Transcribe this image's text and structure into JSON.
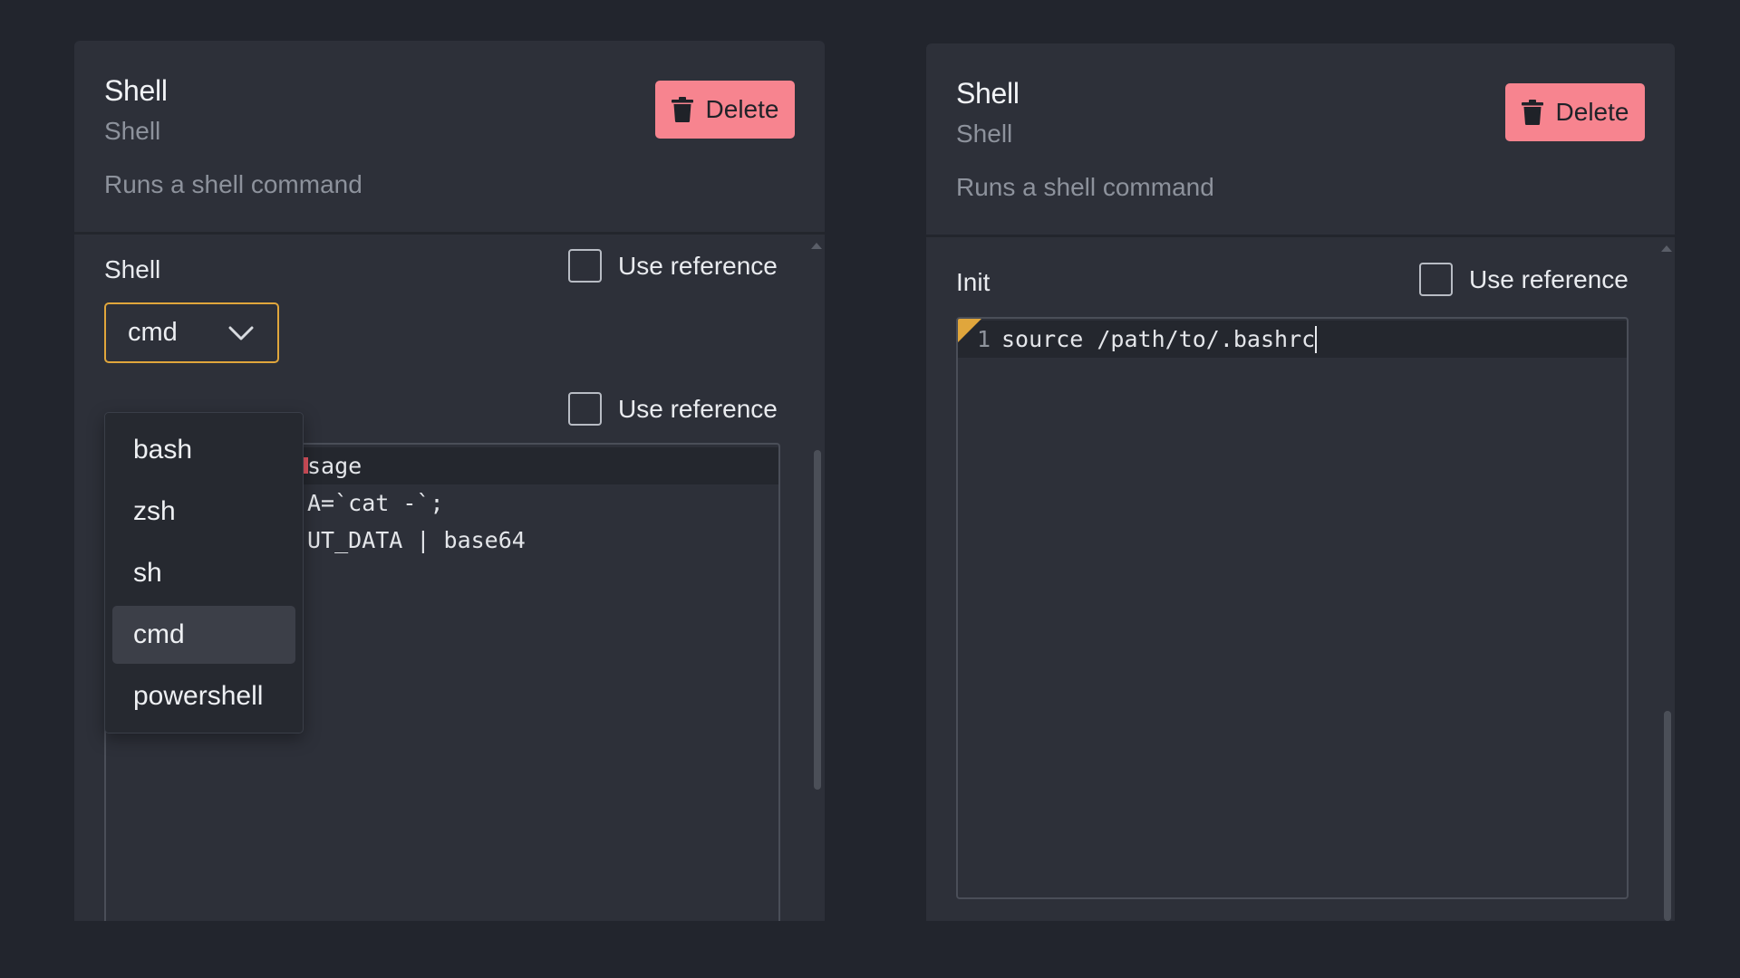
{
  "panels": [
    {
      "title": "Shell",
      "subtitle": "Shell",
      "description": "Runs a shell command",
      "delete_label": "Delete",
      "field_label": "Shell",
      "use_reference_label": "Use reference",
      "second_use_reference_label": "Use reference",
      "select": {
        "value": "cmd",
        "options": [
          "bash",
          "zsh",
          "sh",
          "cmd",
          "powershell"
        ]
      },
      "editor_lines": [
        "sage",
        "A=`cat -`;",
        "UT_DATA | base64"
      ]
    },
    {
      "title": "Shell",
      "subtitle": "Shell",
      "description": "Runs a shell command",
      "delete_label": "Delete",
      "field_label": "Init",
      "use_reference_label": "Use reference",
      "editor_lines": [
        {
          "num": "1",
          "text": "source /path/to/.bashrc"
        }
      ]
    }
  ],
  "colors": {
    "background": "#22252d",
    "panel": "#2d3039",
    "delete_button": "#f7848f",
    "focus_border": "#e0a63c"
  },
  "icons": {
    "delete": "trash-icon",
    "select": "chevron-down-icon"
  }
}
